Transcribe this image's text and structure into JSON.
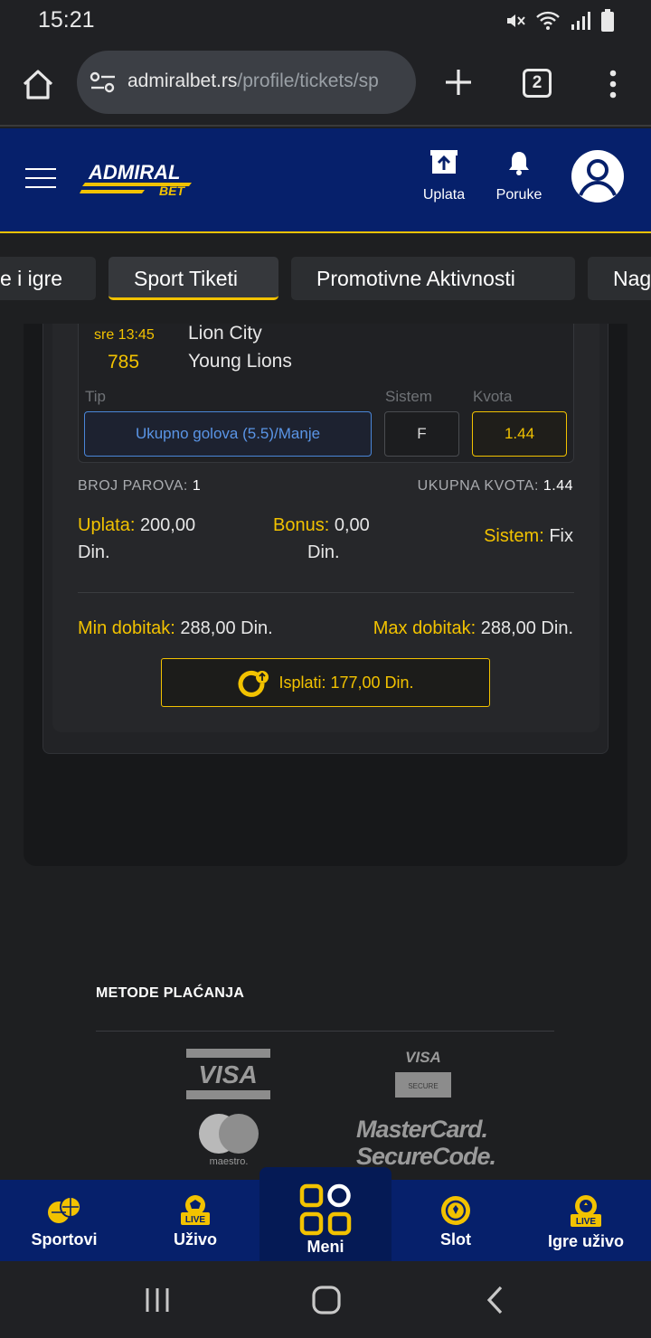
{
  "status_bar": {
    "time": "15:21"
  },
  "browser": {
    "url_host": "admiralbet.rs",
    "url_path": "/profile/tickets/sp",
    "tab_count": "2"
  },
  "header": {
    "logo_top": "ADMIRAL",
    "logo_bottom": "BET",
    "deposit_label": "Uplata",
    "messages_label": "Poruke"
  },
  "tabs": [
    {
      "label": "e i igre"
    },
    {
      "label": "Sport Tiketi",
      "active": true
    },
    {
      "label": "Promotivne Aktivnosti"
    },
    {
      "label": "Nag"
    }
  ],
  "ticket": {
    "match": {
      "time": "sre 13:45",
      "code": "785",
      "home": "Lion City",
      "away": "Young Lions"
    },
    "columns": {
      "tip": "Tip",
      "sistem": "Sistem",
      "kvota": "Kvota"
    },
    "bet": {
      "tip": "Ukupno golova (5.5)/Manje",
      "sistem": "F",
      "kvota": "1.44"
    },
    "broj_parova_label": "BROJ PAROVA:",
    "broj_parova_value": "1",
    "ukupna_kvota_label": "UKUPNA KVOTA:",
    "ukupna_kvota_value": "1.44",
    "uplata_label": "Uplata:",
    "uplata_value": "200,00",
    "uplata_currency": "Din.",
    "bonus_label": "Bonus:",
    "bonus_value": "0,00",
    "bonus_currency": "Din.",
    "sistem_label": "Sistem:",
    "sistem_value": "Fix",
    "min_label": "Min dobitak:",
    "min_value": "288,00 Din.",
    "max_label": "Max dobitak:",
    "max_value": "288,00 Din.",
    "payout_label": "Isplati: 177,00 Din."
  },
  "payment": {
    "title": "METODE PLAĆANJA",
    "visa": "VISA",
    "visa_secure_top": "VISA",
    "visa_secure_bottom": "SECURE",
    "maestro": "maestro.",
    "mc_line1": "MasterCard.",
    "mc_line2": "SecureCode."
  },
  "bottom_nav": {
    "sportovi": "Sportovi",
    "uzivo": "Uživo",
    "uzivo_badge": "LIVE",
    "meni": "Meni",
    "slot": "Slot",
    "igre_uzivo": "Igre uživo",
    "igre_badge": "LIVE"
  },
  "colors": {
    "brand_blue": "#06206b",
    "accent_yellow": "#f2c200",
    "link_blue": "#5a95e6"
  }
}
